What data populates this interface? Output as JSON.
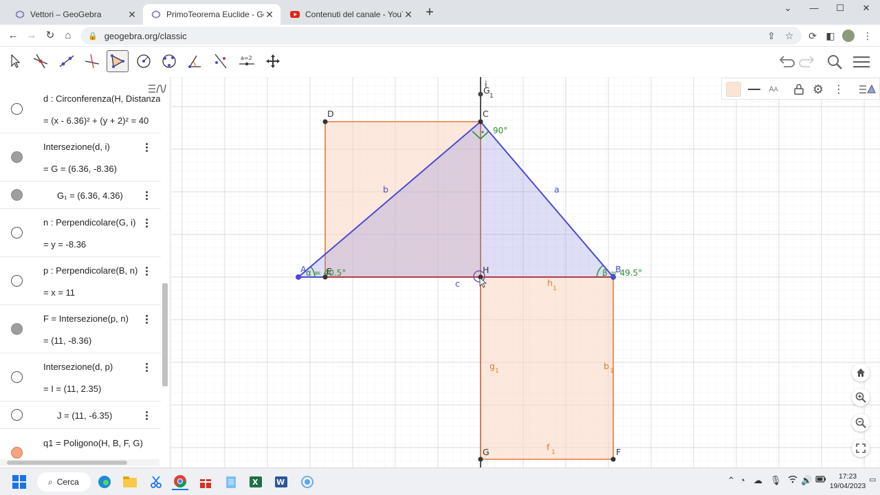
{
  "browser": {
    "tabs": [
      {
        "title": "Vettori – GeoGebra",
        "active": false
      },
      {
        "title": "PrimoTeorema Euclide - GeoGebra",
        "active": true
      },
      {
        "title": "Contenuti del canale - YouTube Studio",
        "active": false
      }
    ],
    "url": "geogebra.org/classic"
  },
  "algebra": {
    "rows": [
      {
        "line1": "d : Circonferenza(H, Distanza(H, I))",
        "line2": "= (x - 6.36)² + (y + 2)² = 40",
        "dot": "empty"
      },
      {
        "line1": "Intersezione(d, i)",
        "line2": "= G = (6.36, -8.36)",
        "dot": "filled"
      },
      {
        "line1": "G₁ = (6.36, 4.36)",
        "line2": "",
        "dot": "filled"
      },
      {
        "line1": "n : Perpendicolare(G, i)",
        "line2": "= y = -8.36",
        "dot": "empty"
      },
      {
        "line1": "p : Perpendicolare(B, n)",
        "line2": "= x = 11",
        "dot": "empty"
      },
      {
        "line1": "F = Intersezione(p, n)",
        "line2": "= (11, -8.36)",
        "dot": "filled"
      },
      {
        "line1": "Intersezione(d, p)",
        "line2": "= I = (11, 2.35)",
        "dot": "empty"
      },
      {
        "line1": "J = (11, -6.35)",
        "line2": "",
        "dot": "empty"
      },
      {
        "line1": "q1 = Poligono(H, B, F, G)",
        "line2": "",
        "dot": "orange"
      }
    ]
  },
  "graphics": {
    "points": {
      "A": "A",
      "B": "B",
      "C": "C",
      "D": "D",
      "E": "E",
      "F": "F",
      "G": "G",
      "H": "H",
      "G1": "G",
      "G1_sub": "1",
      "i": "i"
    },
    "segments": {
      "a": "a",
      "b": "b",
      "c": "c",
      "h1": "h",
      "g1": "g",
      "b1": "b",
      "f1": "f",
      "sub1": "1"
    },
    "angles": {
      "alpha": "α = 40.5°",
      "beta": "β = 49.5°",
      "right": "90°"
    },
    "colors": {
      "triangle": "#4a4ad4",
      "square": "#e07b39",
      "angle": "#2e8b2e",
      "axis": "#222222"
    }
  },
  "taskbar": {
    "search_label": "Cerca",
    "time": "17:23",
    "date": "19/04/2023"
  }
}
